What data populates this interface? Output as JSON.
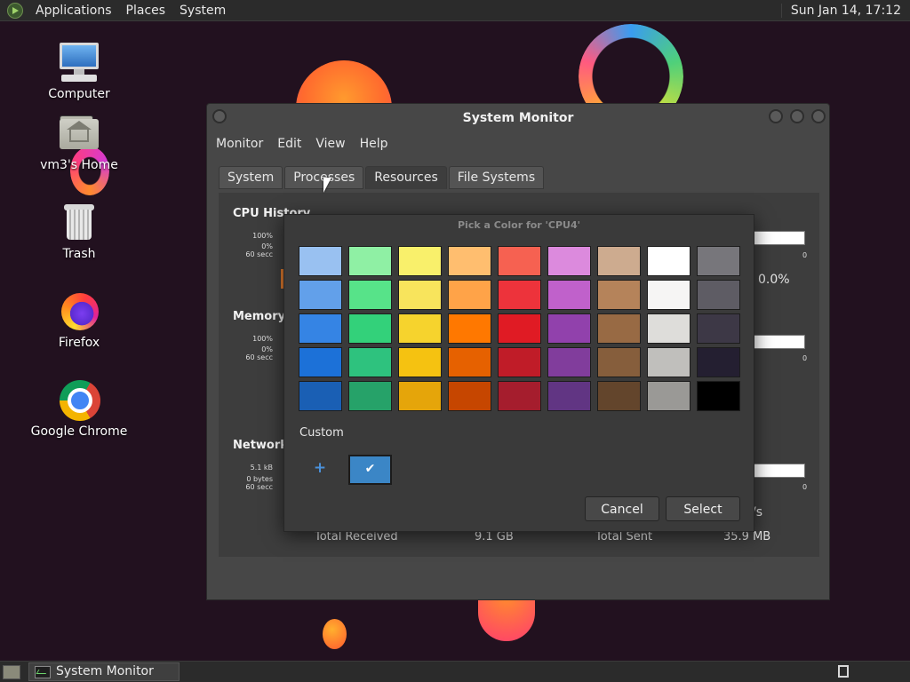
{
  "top_panel": {
    "menus": [
      "Applications",
      "Places",
      "System"
    ],
    "clock": "Sun Jan 14, 17:12"
  },
  "desktop_icons": [
    {
      "label": "Computer",
      "icon": "computer-icon"
    },
    {
      "label": "vm3's Home",
      "icon": "home-folder-icon"
    },
    {
      "label": "Trash",
      "icon": "trash-icon"
    },
    {
      "label": "Firefox",
      "icon": "firefox-icon"
    },
    {
      "label": "Google Chrome",
      "icon": "chrome-icon"
    }
  ],
  "window": {
    "title": "System Monitor",
    "menu": [
      "Monitor",
      "Edit",
      "View",
      "Help"
    ],
    "tabs": [
      "System",
      "Processes",
      "Resources",
      "File Systems"
    ],
    "active_tab": "Resources",
    "sections": {
      "cpu": "CPU History",
      "memory": "Memory a",
      "network": "Network H"
    },
    "cpu_axis": [
      "100%",
      "0%",
      "60 secc"
    ],
    "mem_axis": [
      "100%",
      "0%",
      "60 secc"
    ],
    "net_axis": [
      "5.1 kB",
      "0 bytes",
      "60 secc"
    ],
    "zero_label": "0",
    "cpu_value": "0.0%",
    "net_rate_suffix": "/s",
    "totals": {
      "received_label": "Total Received",
      "received_value": "9.1 GB",
      "sent_label": "Total Sent",
      "sent_value": "35.9 MB"
    }
  },
  "color_dialog": {
    "title": "Pick a Color for 'CPU4'",
    "palette": [
      [
        "#99c1f1",
        "#8ff0a4",
        "#f9f06b",
        "#ffbe6f",
        "#f66151",
        "#dc8add",
        "#cdab8f",
        "#ffffff",
        "#77767b"
      ],
      [
        "#62a0ea",
        "#57e389",
        "#f8e45c",
        "#ffa348",
        "#ed333b",
        "#c061cb",
        "#b5835a",
        "#f6f5f4",
        "#5e5c64"
      ],
      [
        "#3584e4",
        "#33d17a",
        "#f6d32d",
        "#ff7800",
        "#e01b24",
        "#9141ac",
        "#986a44",
        "#deddda",
        "#3d3846"
      ],
      [
        "#1c71d8",
        "#2ec27e",
        "#f5c211",
        "#e66100",
        "#c01c28",
        "#813d9c",
        "#865e3c",
        "#c0bfbc",
        "#241f31"
      ],
      [
        "#1a5fb4",
        "#26a269",
        "#e5a50a",
        "#c64600",
        "#a51d2d",
        "#613583",
        "#63452c",
        "#9a9996",
        "#000000"
      ]
    ],
    "custom_label": "Custom",
    "custom_add": "+",
    "custom_selected_color": "#3b86c6",
    "custom_check": "✔",
    "cancel": "Cancel",
    "select": "Select"
  },
  "bottom_panel": {
    "task_label": "System Monitor"
  }
}
